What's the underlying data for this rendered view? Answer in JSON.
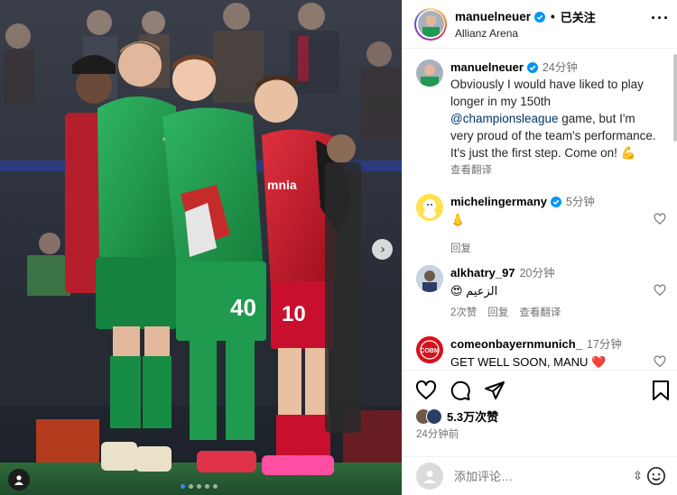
{
  "post": {
    "author": "manuelneuer",
    "follow_status": "已关注",
    "location": "Allianz Arena",
    "caption_timestamp": "24分钟",
    "caption_parts": {
      "p1": "Obviously I would have liked to play longer in my 150th ",
      "mention": "@championsleague",
      "p2": " game, but I'm very proud of the team's performance. It's just the first step. Come on! ",
      "emoji": "💪"
    },
    "see_translation": "查看翻译",
    "likes": "5.3万次赞",
    "posted_ago": "24分钟前",
    "photo_numbers": {
      "left": "40",
      "right": "10"
    },
    "photo_sponsor": "mnia"
  },
  "comments": [
    {
      "username": "michelingermany",
      "time": "5分钟",
      "text": "👃",
      "reply": "回复"
    },
    {
      "username": "alkhatry_97",
      "time": "20分钟",
      "text": "😍 الزعيم",
      "likes": "2次赞",
      "reply": "回复",
      "translate": "查看翻译"
    },
    {
      "username": "comeonbayernmunich_",
      "time": "17分钟",
      "text": "GET WELL SOON, MANU ❤️",
      "badge": "COBM"
    }
  ],
  "composer": {
    "placeholder": "添加评论…",
    "swap": "⇳"
  },
  "icons": [
    "more-icon",
    "verified-icon",
    "heart-icon",
    "comment-icon",
    "share-icon",
    "bookmark-icon",
    "emoji-icon",
    "chevron-right-icon",
    "user-tag-icon"
  ],
  "colors": {
    "verified": "#0095f6",
    "mention": "#00376b",
    "muted": "#737373",
    "heart_red": "#ed4956",
    "jersey_green": "#1f9a4e",
    "jersey_red": "#c8102e"
  }
}
